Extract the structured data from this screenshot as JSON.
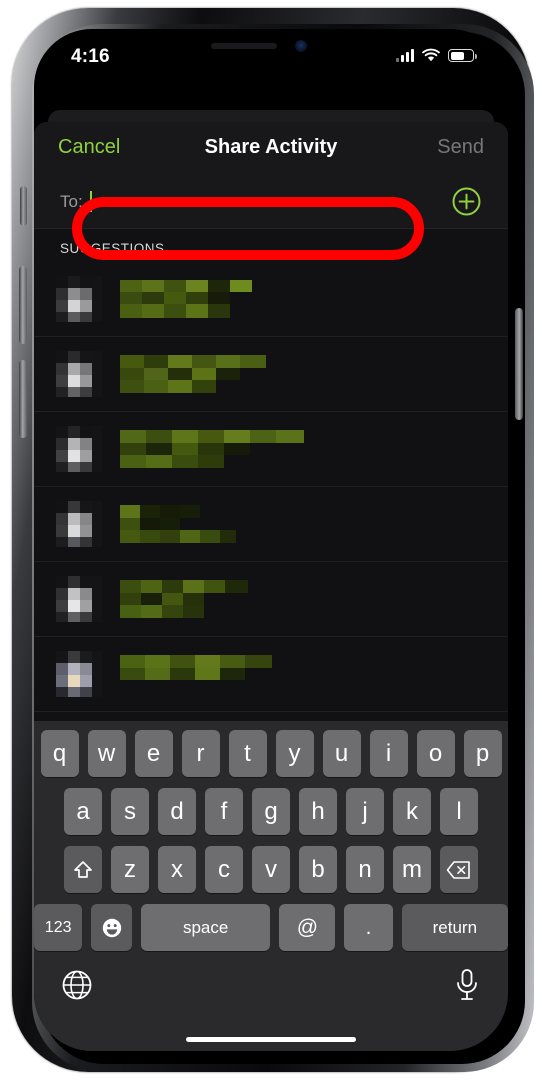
{
  "device": {
    "status_bar": {
      "time": "4:16",
      "signal_icon": "cellular-signal-icon",
      "wifi_icon": "wifi-icon",
      "battery_icon": "battery-icon",
      "battery_level_percent": 62
    },
    "home_indicator": "home-indicator"
  },
  "sheet": {
    "navbar": {
      "cancel_label": "Cancel",
      "title": "Share Activity",
      "send_label": "Send"
    },
    "recipient_field": {
      "label": "To:",
      "value": "",
      "caret_visible": true,
      "add_contact_icon": "plus-circle-icon"
    },
    "annotation": {
      "shape": "rounded-rectangle-outline",
      "color": "#ff0000",
      "target": "recipient-field"
    },
    "suggestions": {
      "header": "SUGGESTIONS",
      "rows": [
        {
          "name": "",
          "redacted": true,
          "avatar": "contact-avatar"
        },
        {
          "name": "",
          "redacted": true,
          "avatar": "contact-avatar"
        },
        {
          "name": "",
          "redacted": true,
          "avatar": "contact-avatar"
        },
        {
          "name": "",
          "redacted": true,
          "avatar": "contact-avatar"
        },
        {
          "name": "",
          "redacted": true,
          "avatar": "contact-avatar"
        },
        {
          "name": "",
          "redacted": true,
          "avatar": "contact-avatar"
        }
      ]
    }
  },
  "keyboard": {
    "layout": "qwerty-lowercase-email",
    "row1": [
      "q",
      "w",
      "e",
      "r",
      "t",
      "y",
      "u",
      "i",
      "o",
      "p"
    ],
    "row2": [
      "a",
      "s",
      "d",
      "f",
      "g",
      "h",
      "j",
      "k",
      "l"
    ],
    "row3": [
      "z",
      "x",
      "c",
      "v",
      "b",
      "n",
      "m"
    ],
    "shift_key": "⇧",
    "backspace_key": "⌫",
    "numbers_key": "123",
    "emoji_key": "☻",
    "space_key": "space",
    "at_key": "@",
    "period_key": ".",
    "return_key": "return",
    "globe_key": "globe-icon",
    "dictation_key": "microphone-icon"
  },
  "colors": {
    "accent_green": "#8fd13f",
    "annotation_red": "#ff0000",
    "sheet_background": "#111113",
    "navbar_background": "#18181a",
    "keyboard_background": "#2a2a2c",
    "key_background": "#6e6e70",
    "key_background_dark": "#5b5b5d",
    "disabled_text": "#77777a"
  }
}
